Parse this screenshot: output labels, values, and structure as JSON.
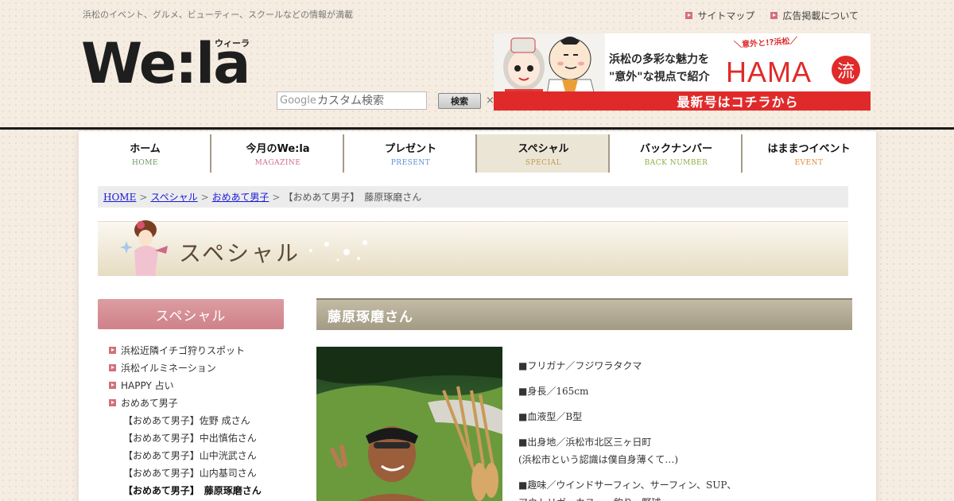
{
  "header": {
    "tagline": "浜松のイベント、グルメ、ビューティー、スクールなどの情報が満載",
    "links": [
      "サイトマップ",
      "広告掲載について"
    ],
    "logo_text": "We:la",
    "logo_ruby": "ウィーラ"
  },
  "search": {
    "google_label": "Google",
    "placeholder": "カスタム検索",
    "button_label": "検索",
    "clear_symbol": "×"
  },
  "banner": {
    "sub": "＼意外と!?浜松／",
    "message_line1": "浜松の多彩な魅力を",
    "message_line2": "\"意外\"な視点で紹介",
    "brand": "HAMA",
    "brand_kanji": "流",
    "cta": "最新号はコチラから",
    "accent_color": "#e02a2a"
  },
  "nav": {
    "items": [
      {
        "jp": "ホーム",
        "en": "HOME",
        "color": "#6a9a62"
      },
      {
        "jp": "今月のWe:la",
        "en": "MAGAZINE",
        "color": "#d46a8c"
      },
      {
        "jp": "プレゼント",
        "en": "PRESENT",
        "color": "#5c8ed6"
      },
      {
        "jp": "スペシャル",
        "en": "SPECIAL",
        "color": "#c09a52"
      },
      {
        "jp": "バックナンバー",
        "en": "BACK NUMBER",
        "color": "#8aae3e"
      },
      {
        "jp": "はままつイベント",
        "en": "EVENT",
        "color": "#e08a3e"
      }
    ],
    "active_index": 3
  },
  "breadcrumb": {
    "home": "HOME",
    "level1": "スペシャル",
    "level2": "おめあて男子",
    "current": "【おめあて男子】　藤原琢磨さん"
  },
  "hero": {
    "title": "スペシャル"
  },
  "sidebar": {
    "title": "スペシャル",
    "items": [
      {
        "label": "浜松近隣イチゴ狩りスポット",
        "type": "top"
      },
      {
        "label": "浜松イルミネーション",
        "type": "top"
      },
      {
        "label": "HAPPY 占い",
        "type": "top"
      },
      {
        "label": "おめあて男子",
        "type": "top"
      },
      {
        "label": "【おめあて男子】佐野 成さん",
        "type": "sub"
      },
      {
        "label": "【おめあて男子】中出慎佑さん",
        "type": "sub"
      },
      {
        "label": "【おめあて男子】山中洸武さん",
        "type": "sub"
      },
      {
        "label": "【おめあて男子】山内基司さん",
        "type": "sub"
      },
      {
        "label": "【おめあて男子】　藤原琢磨さん",
        "type": "current"
      }
    ]
  },
  "main": {
    "title": "藤原琢磨さん",
    "profile": [
      "■フリガナ／フジワラタクマ",
      "■身長／165cm",
      "■血液型／B型",
      "■出身地／浜松市北区三ヶ日町",
      "(浜松市という認識は僕自身薄くて…)",
      "■趣味／ウインドサーフィン、サーフィン、SUP、",
      "アウトリガーカヌー、釣り、野球"
    ]
  }
}
